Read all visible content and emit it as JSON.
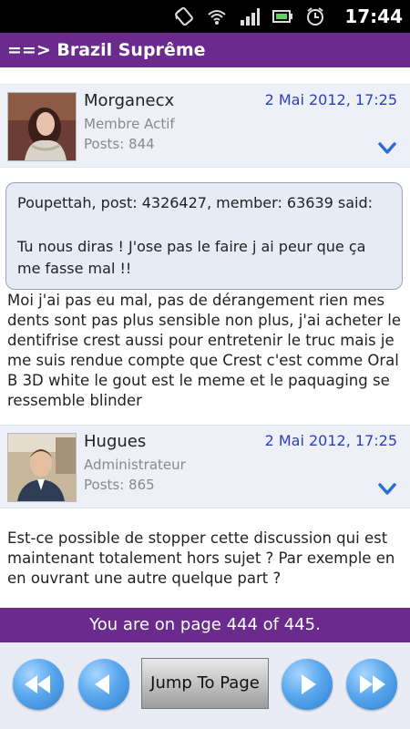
{
  "status_bar": {
    "time": "17:44"
  },
  "title_bar": {
    "title": "==> Brazil Suprême"
  },
  "posts": [
    {
      "username": "Morganecx",
      "role": "Membre Actif",
      "posts": "Posts: 844",
      "date": "2 Mai 2012, 17:25",
      "quote": {
        "header": "Poupettah, post: 4326427, member: 63639 said:",
        "text": "Tu nous diras ! J'ose pas le faire j ai peur que ça me fasse mal !!"
      },
      "body": "Moi j'ai pas eu mal, pas de dérangement rien mes dents sont pas plus sensible non plus, j'ai acheter le dentifrise crest aussi pour entretenir le truc mais je me suis rendue compte que Crest c'est comme Oral B 3D white le gout est le meme et le paquaging se ressemble blinder"
    },
    {
      "username": "Hugues",
      "role": "Administrateur",
      "posts": "Posts: 865",
      "date": "2 Mai 2012, 17:25",
      "body": "Est-ce possible de stopper cette discussion qui est maintenant totalement hors sujet ? Par exemple en en ouvrant une autre quelque part ?"
    }
  ],
  "pagination": {
    "status": "You are on page 444 of 445.",
    "jump_label": "Jump To Page"
  },
  "icons": [
    "rotate-icon",
    "wifi-icon",
    "signal-icon",
    "battery-icon",
    "alarm-icon",
    "expand-chevron-icon",
    "first-page-icon",
    "prev-page-icon",
    "next-page-icon",
    "last-page-icon"
  ],
  "colors": {
    "accent": "#6a2b8c",
    "date": "#2a3fb8",
    "nav_button": "#4a9be6"
  }
}
